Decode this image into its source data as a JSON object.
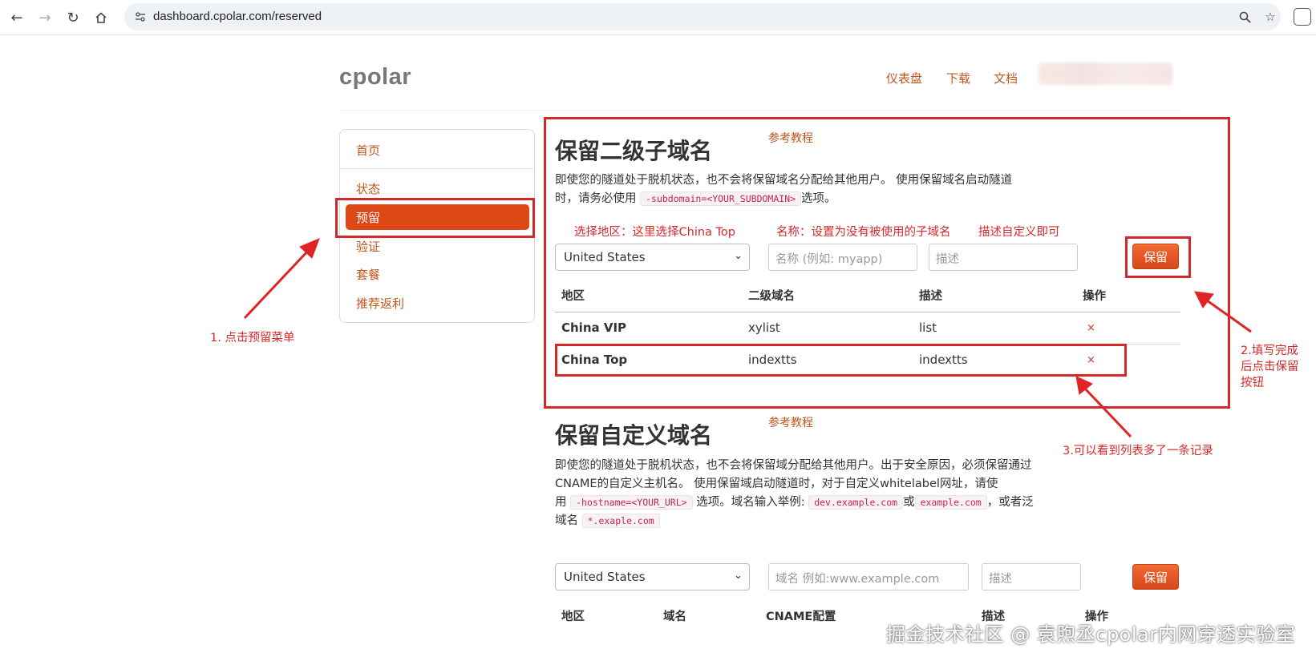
{
  "browser": {
    "url": "dashboard.cpolar.com/reserved"
  },
  "header": {
    "logo": "cpolar",
    "nav": [
      "仪表盘",
      "下载",
      "文档"
    ]
  },
  "sidebar": {
    "items": [
      "首页",
      "状态",
      "预留",
      "验证",
      "套餐",
      "推荐返利"
    ],
    "active": "预留"
  },
  "section1": {
    "title": "保留二级子域名",
    "ref_link": "参考教程",
    "desc_part1": "即使您的隧道处于脱机状态，也不会将保留域名分配给其他用户。 使用保留域名启动隧道",
    "desc_part2a": "时，请务必使用",
    "desc_code": "-subdomain=<YOUR_SUBDOMAIN>",
    "desc_part2b": "选项。",
    "form": {
      "region_value": "United States",
      "name_placeholder": "名称 (例如: myapp)",
      "desc_placeholder": "描述",
      "save_label": "保留"
    },
    "table": {
      "headers": [
        "地区",
        "二级域名",
        "描述",
        "操作"
      ],
      "rows": [
        {
          "region": "China VIP",
          "subdomain": "xylist",
          "desc": "list",
          "action": "×"
        },
        {
          "region": "China Top",
          "subdomain": "indextts",
          "desc": "indextts",
          "action": "×"
        }
      ]
    }
  },
  "section2": {
    "title": "保留自定义域名",
    "ref_link": "参考教程",
    "line1": "即使您的隧道处于脱机状态，也不会将保留域分配给其他用户。出于安全原因，必须保留通过",
    "line2": "CNAME的自定义主机名。 使用保留域启动隧道时，对于自定义whitelabel网址，请使",
    "line3a": "用",
    "line3_code": "-hostname=<YOUR_URL>",
    "line3b": "选项。域名输入举例:",
    "line3_code2": "dev.example.com",
    "line3c": "或",
    "line3_code3": "example.com",
    "line3d": "，或者泛",
    "line4a": "域名",
    "line4_code": "*.exaple.com",
    "form": {
      "region_value": "United States",
      "domain_placeholder": "域名 例如:www.example.com",
      "desc_placeholder": "描述",
      "save_label": "保留"
    },
    "table": {
      "headers": [
        "地区",
        "域名",
        "CNAME配置",
        "描述",
        "操作"
      ]
    }
  },
  "annotations": {
    "step1": "1. 点击预留菜单",
    "select_region": "选择地区：这里选择China Top",
    "name_hint": "名称：设置为没有被使用的子域名",
    "desc_hint": "描述自定义即可",
    "step2_line1": "2.填写完成",
    "step2_line2": "后点击保留",
    "step2_line3": "按钮",
    "step3": "3.可以看到列表多了一条记录",
    "color": "#d62828"
  },
  "watermark": "掘金技术社区 @ 袁煦丞cpolar内网穿透实验室",
  "colors": {
    "accent": "#dd4814",
    "link": "#c0561e"
  }
}
